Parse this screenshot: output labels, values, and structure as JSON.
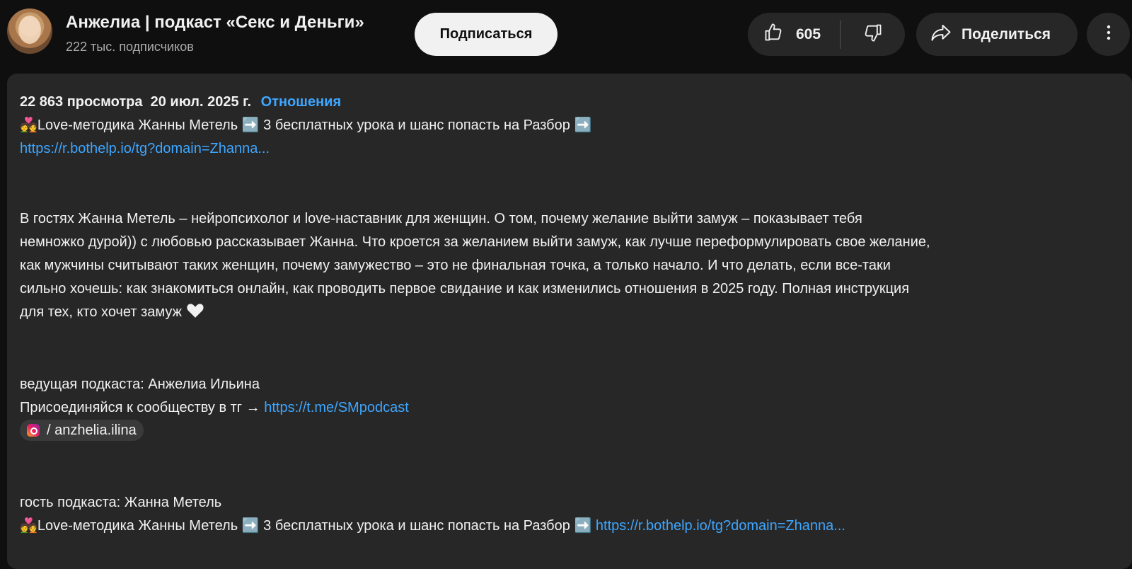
{
  "channel": {
    "name": "Анжелиа | подкаст «Секс и Деньги»",
    "subscribers": "222 тыс. подписчиков"
  },
  "actions": {
    "subscribe_label": "Подписаться",
    "like_count": "605",
    "share_label": "Поделиться"
  },
  "description": {
    "views": "22 863 просмотра",
    "date": "20 июл. 2025 г.",
    "tag": "Отношения",
    "promo_line": "Love-методика Жанны Метель ➡️ 3 бесплатных урока и шанс попасть на Разбор ➡️",
    "promo_link": "https://r.bothelp.io/tg?domain=Zhanna...",
    "paragraph_1": "В гостях Жанна Метель – нейропсихолог и love-наставник для женщин. О том, почему желание выйти замуж – показывает тебя",
    "paragraph_2": "немножко дурой)) с любовью рассказывает Жанна. Что кроется за желанием выйти замуж, как лучше переформулировать свое желание,",
    "paragraph_3": "как мужчины считывают таких женщин, почему замужество – это не финальная точка, а только начало. И что делать, если все-таки",
    "paragraph_4": "сильно хочешь: как знакомиться онлайн, как проводить первое свидание и как изменились отношения в 2025 году. Полная инструкция",
    "paragraph_5": "для тех, кто хочет замуж",
    "host_line": "ведущая подкаста: Анжелиа Ильина",
    "community_text": "Присоединяйся к сообществу в тг →",
    "community_link": "https://t.me/SMpodcast",
    "instagram_handle": "/ anzhelia.ilina",
    "guest_line": "гость подкаста: Жанна Метель",
    "guest_promo": "Love-методика Жанны Метель ➡️ 3 бесплатных урока и шанс попасть на Разбор ➡️",
    "guest_link": "https://r.bothelp.io/tg?domain=Zhanna..."
  }
}
